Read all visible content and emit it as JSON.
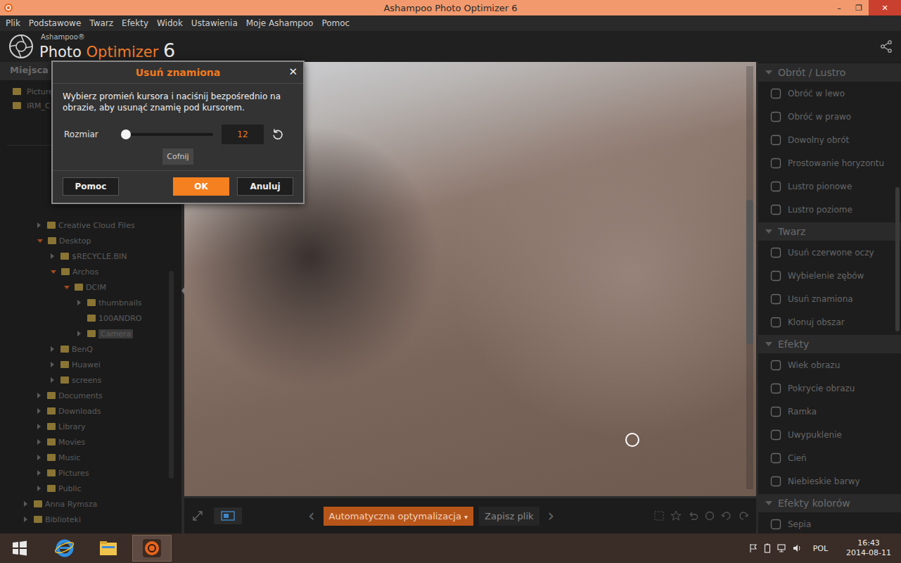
{
  "window": {
    "title": "Ashampoo Photo Optimizer 6",
    "controls": [
      "–",
      "❐",
      "✕"
    ]
  },
  "menu": [
    "Plik",
    "Podstawowe",
    "Twarz",
    "Efekty",
    "Widok",
    "Ustawienia",
    "Moje Ashampoo",
    "Pomoc"
  ],
  "header": {
    "brand": "Ashampoo®",
    "product": "Photo",
    "product_accent": "Optimizer",
    "version": "6"
  },
  "places": {
    "title": "Miejsca",
    "items": [
      "Pictures",
      "IRM_C"
    ]
  },
  "tree": [
    {
      "label": "Creative Cloud Files",
      "level": 1,
      "has_children": true,
      "expanded": false,
      "selected": false
    },
    {
      "label": "Desktop",
      "level": 1,
      "has_children": true,
      "expanded": true,
      "selected": false
    },
    {
      "label": "$RECYCLE.BIN",
      "level": 2,
      "has_children": true,
      "expanded": false,
      "selected": false
    },
    {
      "label": "Archos",
      "level": 2,
      "has_children": true,
      "expanded": true,
      "selected": false
    },
    {
      "label": "DCIM",
      "level": 3,
      "has_children": true,
      "expanded": true,
      "selected": false
    },
    {
      "label": "thumbnails",
      "level": 4,
      "has_children": true,
      "expanded": false,
      "selected": false
    },
    {
      "label": "100ANDRO",
      "level": 4,
      "has_children": false,
      "expanded": false,
      "selected": false
    },
    {
      "label": "Camera",
      "level": 4,
      "has_children": true,
      "expanded": false,
      "selected": true
    },
    {
      "label": "BenQ",
      "level": 2,
      "has_children": true,
      "expanded": false,
      "selected": false
    },
    {
      "label": "Huawei",
      "level": 2,
      "has_children": true,
      "expanded": false,
      "selected": false
    },
    {
      "label": "screens",
      "level": 2,
      "has_children": true,
      "expanded": false,
      "selected": false
    },
    {
      "label": "Documents",
      "level": 1,
      "has_children": true,
      "expanded": false,
      "selected": false
    },
    {
      "label": "Downloads",
      "level": 1,
      "has_children": true,
      "expanded": false,
      "selected": false
    },
    {
      "label": "Library",
      "level": 1,
      "has_children": true,
      "expanded": false,
      "selected": false
    },
    {
      "label": "Movies",
      "level": 1,
      "has_children": true,
      "expanded": false,
      "selected": false
    },
    {
      "label": "Music",
      "level": 1,
      "has_children": true,
      "expanded": false,
      "selected": false
    },
    {
      "label": "Pictures",
      "level": 1,
      "has_children": true,
      "expanded": false,
      "selected": false
    },
    {
      "label": "Public",
      "level": 1,
      "has_children": true,
      "expanded": false,
      "selected": false
    },
    {
      "label": "Anna Rymsza",
      "level": 0,
      "has_children": true,
      "expanded": false,
      "selected": false
    },
    {
      "label": "Biblioteki",
      "level": 0,
      "has_children": true,
      "expanded": false,
      "selected": false
    }
  ],
  "tools": [
    {
      "title": "Obrót / Lustro",
      "expanded": true,
      "items": [
        "Obróć w lewo",
        "Obróć w prawo",
        "Dowolny obrót",
        "Prostowanie horyzontu",
        "Lustro pionowe",
        "Lustro poziome"
      ]
    },
    {
      "title": "Twarz",
      "expanded": true,
      "items": [
        "Usuń czerwone oczy",
        "Wybielenie zębów",
        "Usuń znamiona",
        "Klonuj obszar"
      ]
    },
    {
      "title": "Efekty",
      "expanded": true,
      "items": [
        "Wiek obrazu",
        "Pokrycie obrazu",
        "Ramka",
        "Uwypuklenie",
        "Cień",
        "Niebieskie barwy"
      ]
    },
    {
      "title": "Efekty kolorów",
      "expanded": true,
      "items": [
        "Sepia"
      ]
    }
  ],
  "toolbar": {
    "prev": "‹",
    "auto": "Automatyczna optymalizacja",
    "auto_arrow": "▾",
    "save": "Zapisz plik",
    "next": "›"
  },
  "dialog": {
    "title": "Usuń znamiona",
    "close": "✕",
    "instructions": "Wybierz promień kursora i naciśnij bezpośrednio na obrazie, aby usunąć znamię pod kursorem.",
    "size_label": "Rozmiar",
    "size_value": "12",
    "level": 0.0,
    "undo": "Cofnij",
    "buttons": [
      {
        "label": "Pomoc",
        "primary": false
      },
      {
        "label": "OK",
        "primary": true
      },
      {
        "label": "Anuluj",
        "primary": false
      }
    ]
  },
  "taskbar": {
    "language": "POL",
    "time": "16:43",
    "date": "2014-08-11"
  }
}
